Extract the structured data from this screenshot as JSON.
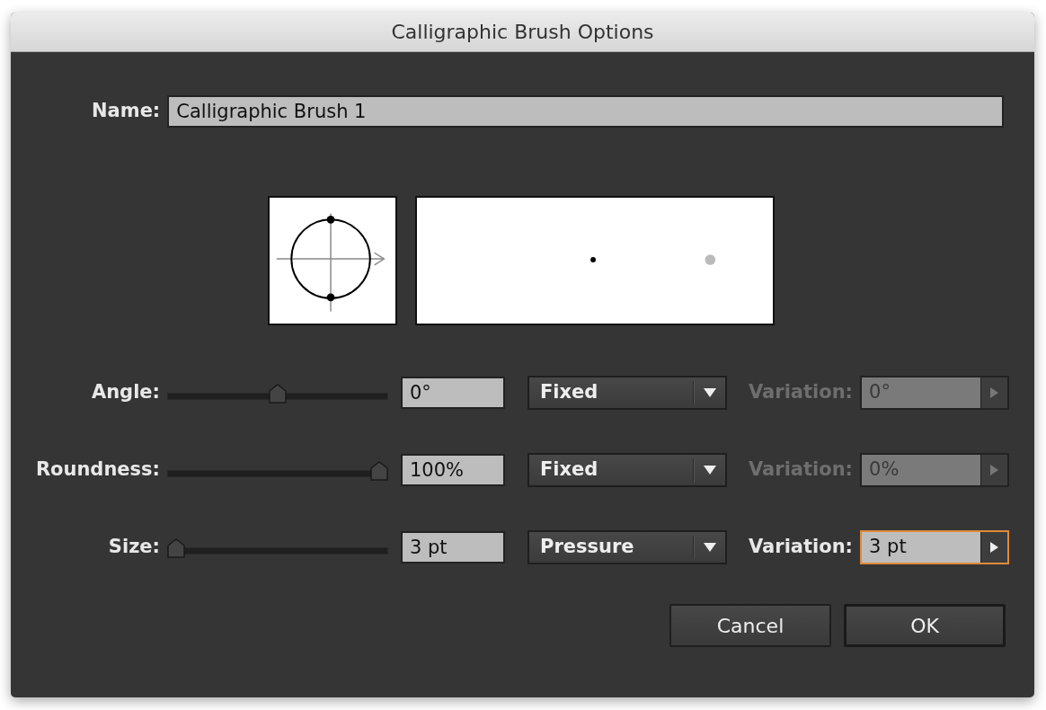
{
  "window": {
    "title": "Calligraphic Brush Options"
  },
  "name_field": {
    "label": "Name:",
    "value": "Calligraphic Brush 1"
  },
  "settings": [
    {
      "label": "Angle:",
      "level": 0.5,
      "value": "0°",
      "method": "Fixed",
      "variation": {
        "label": "Variation:",
        "value": "0°",
        "disabled": true,
        "focused": false
      }
    },
    {
      "label": "Roundness:",
      "level": 1.0,
      "value": "100%",
      "method": "Fixed",
      "variation": {
        "label": "Variation:",
        "value": "0%",
        "disabled": true,
        "focused": false
      }
    },
    {
      "label": "Size:",
      "level": 0.0,
      "value": "3 pt",
      "method": "Pressure",
      "variation": {
        "label": "Variation:",
        "value": "3 pt",
        "disabled": false,
        "focused": true
      }
    }
  ],
  "buttons": [
    {
      "label": "Cancel",
      "kind": "secondary"
    },
    {
      "label": "OK",
      "kind": "default"
    }
  ]
}
